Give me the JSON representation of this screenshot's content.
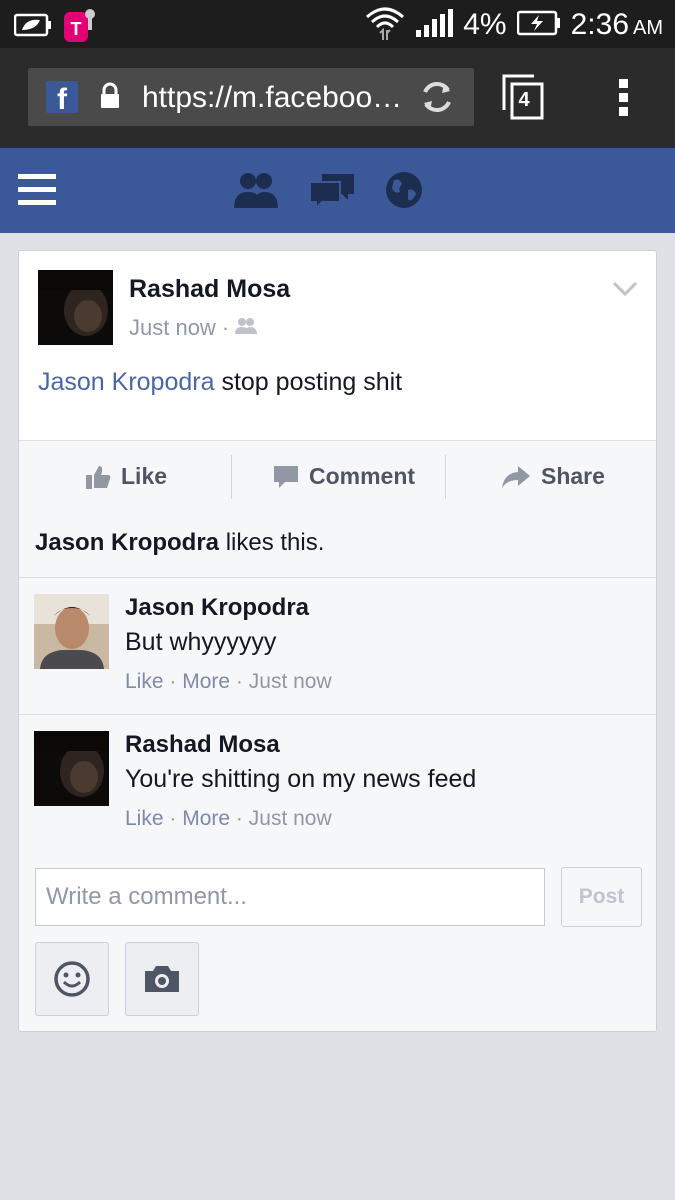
{
  "status_bar": {
    "battery_percent": "4%",
    "time": "2:36",
    "ampm": "AM",
    "carrier_icon": "t-mobile-icon"
  },
  "browser": {
    "url": "https://m.faceboo…",
    "tab_count": "4"
  },
  "post": {
    "author": "Rashad Mosa",
    "timestamp": "Just now",
    "tagged_name": "Jason Kropodra",
    "text": " stop posting shit",
    "actions": {
      "like": "Like",
      "comment": "Comment",
      "share": "Share"
    }
  },
  "likes": {
    "name": "Jason Kropodra",
    "suffix": " likes this."
  },
  "comments": [
    {
      "author": "Jason Kropodra",
      "text": "But whyyyyyy",
      "like": "Like",
      "more": "More",
      "time": "Just now"
    },
    {
      "author": "Rashad Mosa",
      "text": "You're shitting on my news feed",
      "like": "Like",
      "more": "More",
      "time": "Just now"
    }
  ],
  "compose": {
    "placeholder": "Write a comment...",
    "post_label": "Post"
  },
  "colors": {
    "facebook_blue": "#3b5998",
    "link_blue": "#4b67a1"
  }
}
